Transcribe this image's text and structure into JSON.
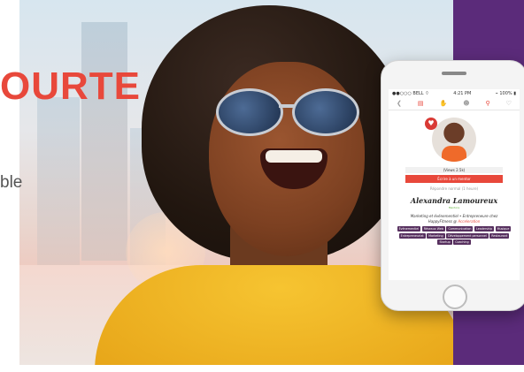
{
  "headline": "OURTE",
  "subline": "ble",
  "phone": {
    "status_bar": {
      "carrier": "●●○○○ BELL ⌔",
      "time": "4:21 PM",
      "battery": "⌁ 100% ▮"
    },
    "nav_icons": [
      "back-icon",
      "chat-icon",
      "handshake-icon",
      "people-icon",
      "search-icon",
      "heart-icon"
    ],
    "follow_count": "(Views 2.5k)",
    "follow_button": "Écrire à un mentor",
    "visibility_text": "Répondre normal (1 heure)",
    "profile_name": "Alexandra Lamoureux",
    "verified_label": "Mentore",
    "bio_line1": "Marketing et événementiel • Entrepreneure chez",
    "bio_line2_prefix": "HappyFitness @ ",
    "bio_company": "Acceleration",
    "tags": [
      "Événementiel",
      "Réseaux Web",
      "Communication",
      "Leadership",
      "Musique",
      "Entrepreneuriat",
      "Marketing",
      "Développement personnel",
      "Restaurant",
      "Startup",
      "Coaching"
    ]
  },
  "colors": {
    "accent": "#e8483b",
    "purple": "#5b2b7a",
    "tag_bg": "#57305f",
    "shirt": "#f6c431"
  }
}
